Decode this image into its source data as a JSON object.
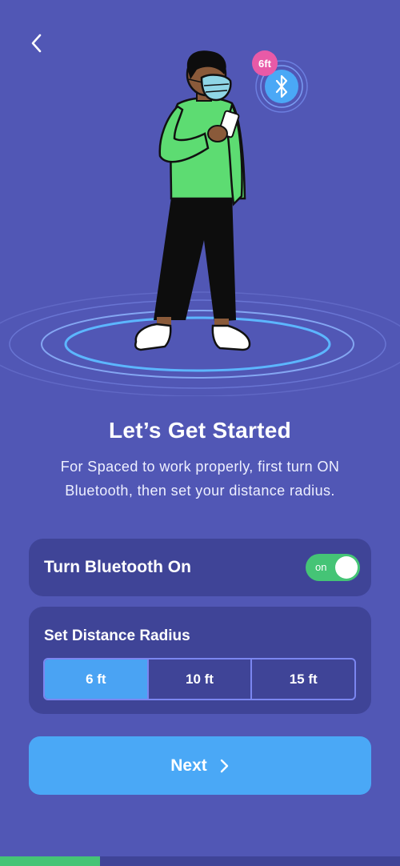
{
  "header": {
    "back_icon": "chevron-left-icon"
  },
  "hero": {
    "distance_badge": "6ft",
    "bluetooth_icon": "bluetooth-icon"
  },
  "intro": {
    "title": "Let’s Get Started",
    "subtitle": "For Spaced to work properly, first turn ON Bluetooth, then set your distance radius."
  },
  "bluetooth": {
    "label": "Turn Bluetooth On",
    "toggle_text": "on",
    "enabled": true
  },
  "radius": {
    "label": "Set Distance Radius",
    "options": [
      "6 ft",
      "10 ft",
      "15 ft"
    ],
    "selected": "6 ft"
  },
  "next_button": {
    "label": "Next",
    "icon": "chevron-right-icon"
  },
  "progress": {
    "fraction": 0.25
  },
  "colors": {
    "background": "#5157b5",
    "card": "#3f4497",
    "accent_blue": "#4aa8f6",
    "toggle_green": "#45c476"
  }
}
